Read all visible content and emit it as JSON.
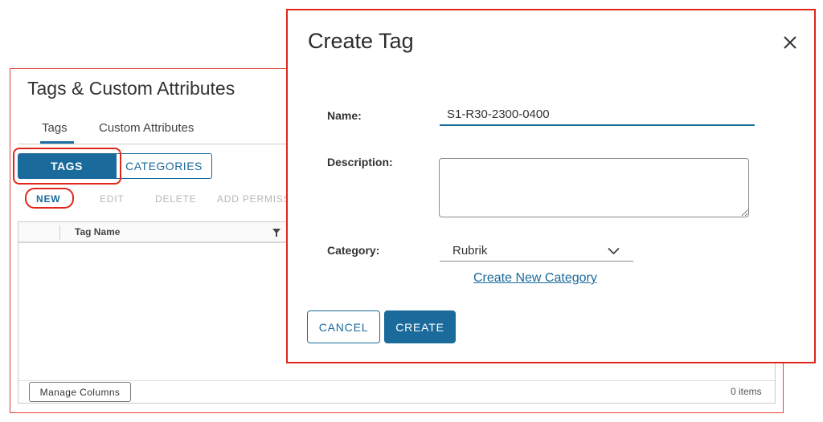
{
  "background_panel": {
    "title": "Tags & Custom Attributes",
    "subtabs": [
      {
        "label": "Tags",
        "active": true
      },
      {
        "label": "Custom Attributes",
        "active": false
      }
    ],
    "segmented": {
      "tags_label": "TAGS",
      "categories_label": "CATEGORIES",
      "selected": "TAGS"
    },
    "actions": {
      "new_label": "NEW",
      "edit_label": "EDIT",
      "delete_label": "DELETE",
      "add_permission_label": "ADD PERMISS"
    },
    "grid": {
      "columns": [
        "Tag Name"
      ],
      "rows": [],
      "manage_columns_label": "Manage Columns",
      "items_count": "0 items"
    }
  },
  "modal": {
    "title": "Create Tag",
    "fields": {
      "name_label": "Name:",
      "name_value": "S1-R30-2300-0400",
      "description_label": "Description:",
      "description_value": "",
      "category_label": "Category:",
      "category_value": "Rubrik"
    },
    "create_category_link": "Create New Category",
    "cancel_label": "CANCEL",
    "create_label": "CREATE"
  },
  "colors": {
    "accent": "#1a6a9b",
    "highlight": "#e0261c",
    "disabled_text": "#b7b7b7"
  },
  "icons": [
    "close-icon",
    "filter-icon",
    "chevron-down-icon"
  ]
}
